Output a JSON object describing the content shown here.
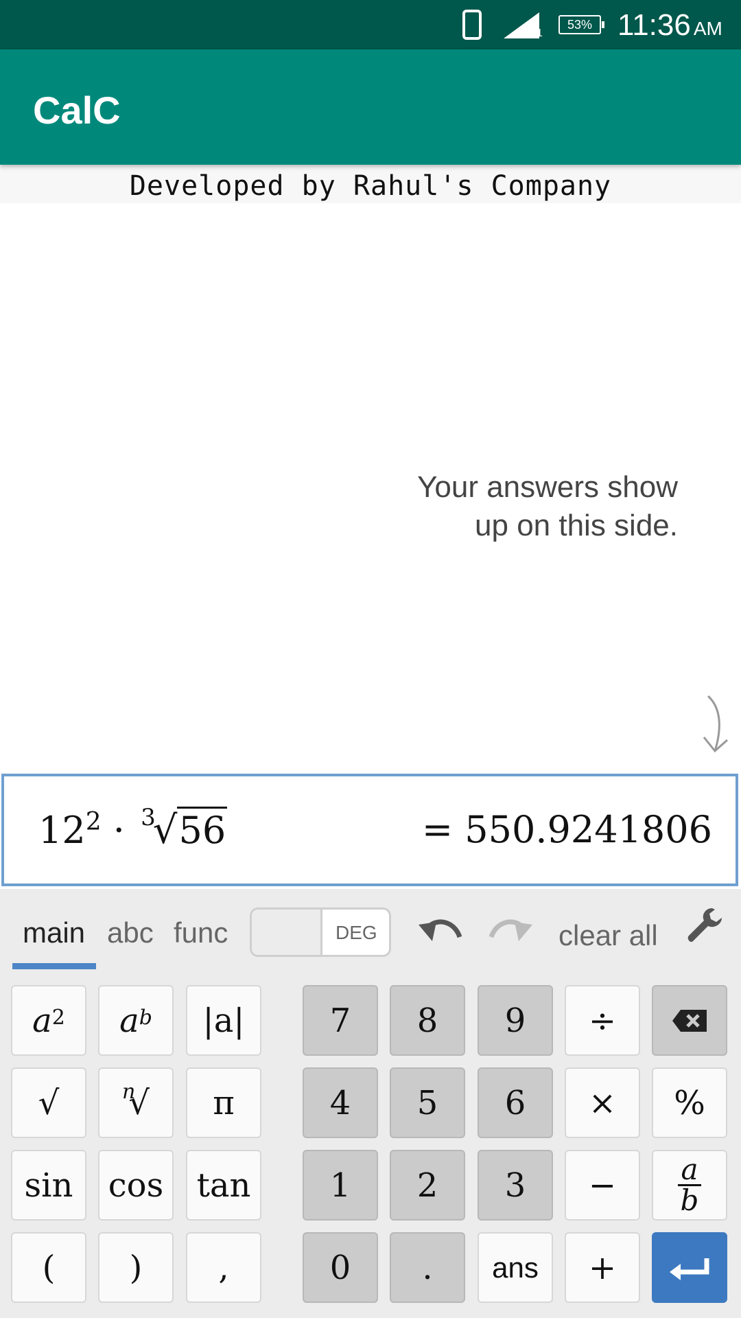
{
  "status_bar": {
    "battery": "53%",
    "signal_sub": "1",
    "time": "11:36",
    "ampm": "AM"
  },
  "app_bar": {
    "title": "CalC"
  },
  "banner": {
    "text": "Developed by Rahul's Company"
  },
  "hint": {
    "line1": "Your answers show",
    "line2": "up on this side."
  },
  "expression": {
    "base": "12",
    "exponent": "2",
    "dot": "·",
    "root_index": "3",
    "radical": "√",
    "radicand": "56",
    "result": "= 550.9241806"
  },
  "keyboard": {
    "tabs": {
      "main": "main",
      "abc": "abc",
      "func": "func"
    },
    "active_tab": "main",
    "angle_mode": "DEG",
    "clear_all": "clear all",
    "keys": {
      "square_base": "a",
      "square_exp": "2",
      "power_base": "a",
      "power_exp": "b",
      "abs": "|a|",
      "sqrt": "√",
      "nroot_index": "n",
      "nroot_sign": "√",
      "pi": "π",
      "sin": "sin",
      "cos": "cos",
      "tan": "tan",
      "lparen": "(",
      "rparen": ")",
      "comma": ",",
      "d7": "7",
      "d8": "8",
      "d9": "9",
      "d4": "4",
      "d5": "5",
      "d6": "6",
      "d1": "1",
      "d2": "2",
      "d3": "3",
      "d0": "0",
      "dot": ".",
      "ans": "ans",
      "divide": "÷",
      "multiply": "×",
      "minus": "−",
      "plus": "+",
      "percent": "%",
      "frac_num": "a",
      "frac_den": "b"
    }
  },
  "colors": {
    "status_bar": "#00574b",
    "app_bar": "#00897b",
    "accent": "#4d86c6",
    "enter_key": "#3d79c0",
    "number_key": "#cbcbcb"
  },
  "icons": [
    "phone-icon",
    "signal-icon",
    "battery-icon",
    "arrow-down-icon",
    "undo-icon",
    "redo-icon",
    "wrench-icon",
    "backspace-icon",
    "enter-icon"
  ]
}
